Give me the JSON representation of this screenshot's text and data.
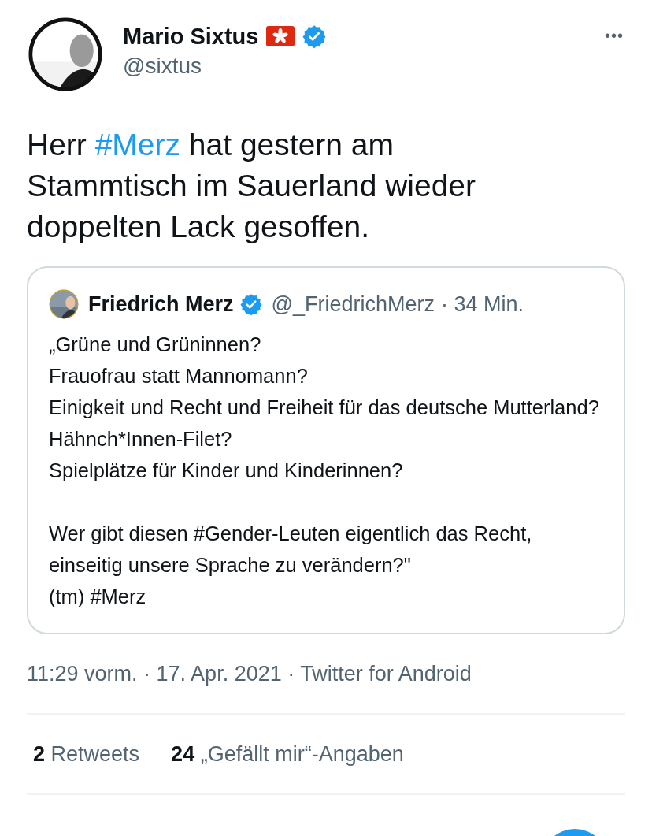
{
  "author": {
    "name": "Mario Sixtus",
    "handle": "@sixtus",
    "verified": true
  },
  "more_button": "•••",
  "body": [
    {
      "kind": "text",
      "text": "Herr "
    },
    {
      "kind": "hashtag",
      "text": "#Merz"
    },
    {
      "kind": "text",
      "text": " hat gestern am Stammtisch im Sauerland wieder doppelten Lack gesoffen."
    }
  ],
  "quoted_tweet": {
    "name": "Friedrich Merz",
    "verified": true,
    "handle": "@_FriedrichMerz",
    "time": "· 34 Min.",
    "paragraphs": [
      "„Grüne und Grüninnen?\nFrauofrau statt Mannomann?\nEinigkeit und Recht und Freiheit für das deutsche Mutterland?\nHähnch*Innen-Filet?\nSpielplätze für Kinder und Kinderinnen?",
      "Wer gibt diesen #Gender-Leuten eigentlich das Recht, einseitig unsere Sprache zu verändern?\"\n(tm) #Merz"
    ]
  },
  "meta": "11:29 vorm. · 17. Apr. 2021 · Twitter for Android",
  "stats": [
    {
      "count": "2",
      "label": "Retweets"
    },
    {
      "count": "24",
      "label": "„Gefällt mir“-Angaben"
    }
  ]
}
